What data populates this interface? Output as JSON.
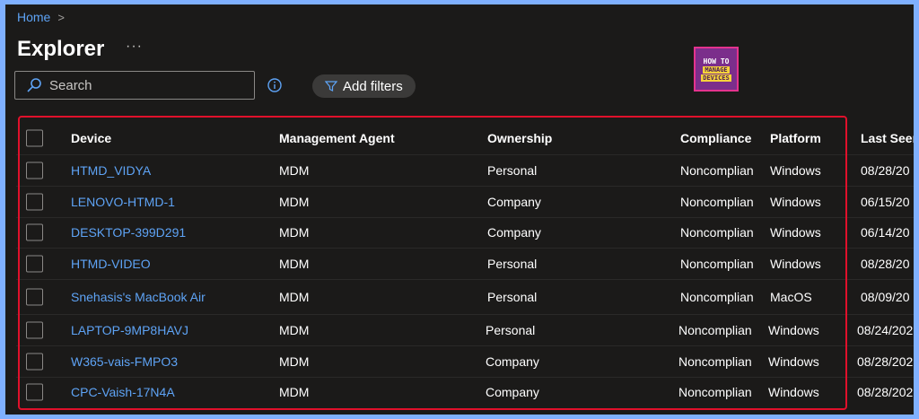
{
  "breadcrumb": {
    "home": "Home",
    "chevron": ">"
  },
  "page": {
    "title": "Explorer",
    "more": "···"
  },
  "search": {
    "placeholder": "Search",
    "value": ""
  },
  "toolbar": {
    "add_filters": "Add filters"
  },
  "logo": {
    "line1": "HOW TO",
    "line2": "MANAGE",
    "line3": "DEVICES"
  },
  "table": {
    "headers": [
      "Device",
      "Management Agent",
      "Ownership",
      "Compliance",
      "Platform",
      "Last Seen"
    ],
    "rows": [
      [
        "HTMD_VIDYA",
        "MDM",
        "Personal",
        "Noncomplian",
        "Windows",
        "08/28/20"
      ],
      [
        "LENOVO-HTMD-1",
        "MDM",
        "Company",
        "Noncomplian",
        "Windows",
        "06/15/20"
      ],
      [
        "DESKTOP-399D291",
        "MDM",
        "Company",
        "Noncomplian",
        "Windows",
        "06/14/20"
      ],
      [
        "HTMD-VIDEO",
        "MDM",
        "Personal",
        "Noncomplian",
        "Windows",
        "08/28/20"
      ],
      [
        "Snehasis's MacBook Air",
        "MDM",
        "Personal",
        "Noncomplian",
        "MacOS",
        "08/09/20"
      ],
      [
        "LAPTOP-9MP8HAVJ",
        "MDM",
        "Personal",
        "Noncomplian",
        "Windows",
        "08/24/202"
      ],
      [
        "W365-vais-FMPO3",
        "MDM",
        "Company",
        "Noncomplian",
        "Windows",
        "08/28/202"
      ],
      [
        "CPC-Vaish-17N4A",
        "MDM",
        "Company",
        "Noncomplian",
        "Windows",
        "08/28/202"
      ]
    ]
  },
  "colors": {
    "accent": "#5ea3f5",
    "highlight": "#e0102b",
    "background": "#1b1a19"
  },
  "icons": {
    "search": "search-icon",
    "info": "info-icon",
    "filter": "filter-icon"
  }
}
